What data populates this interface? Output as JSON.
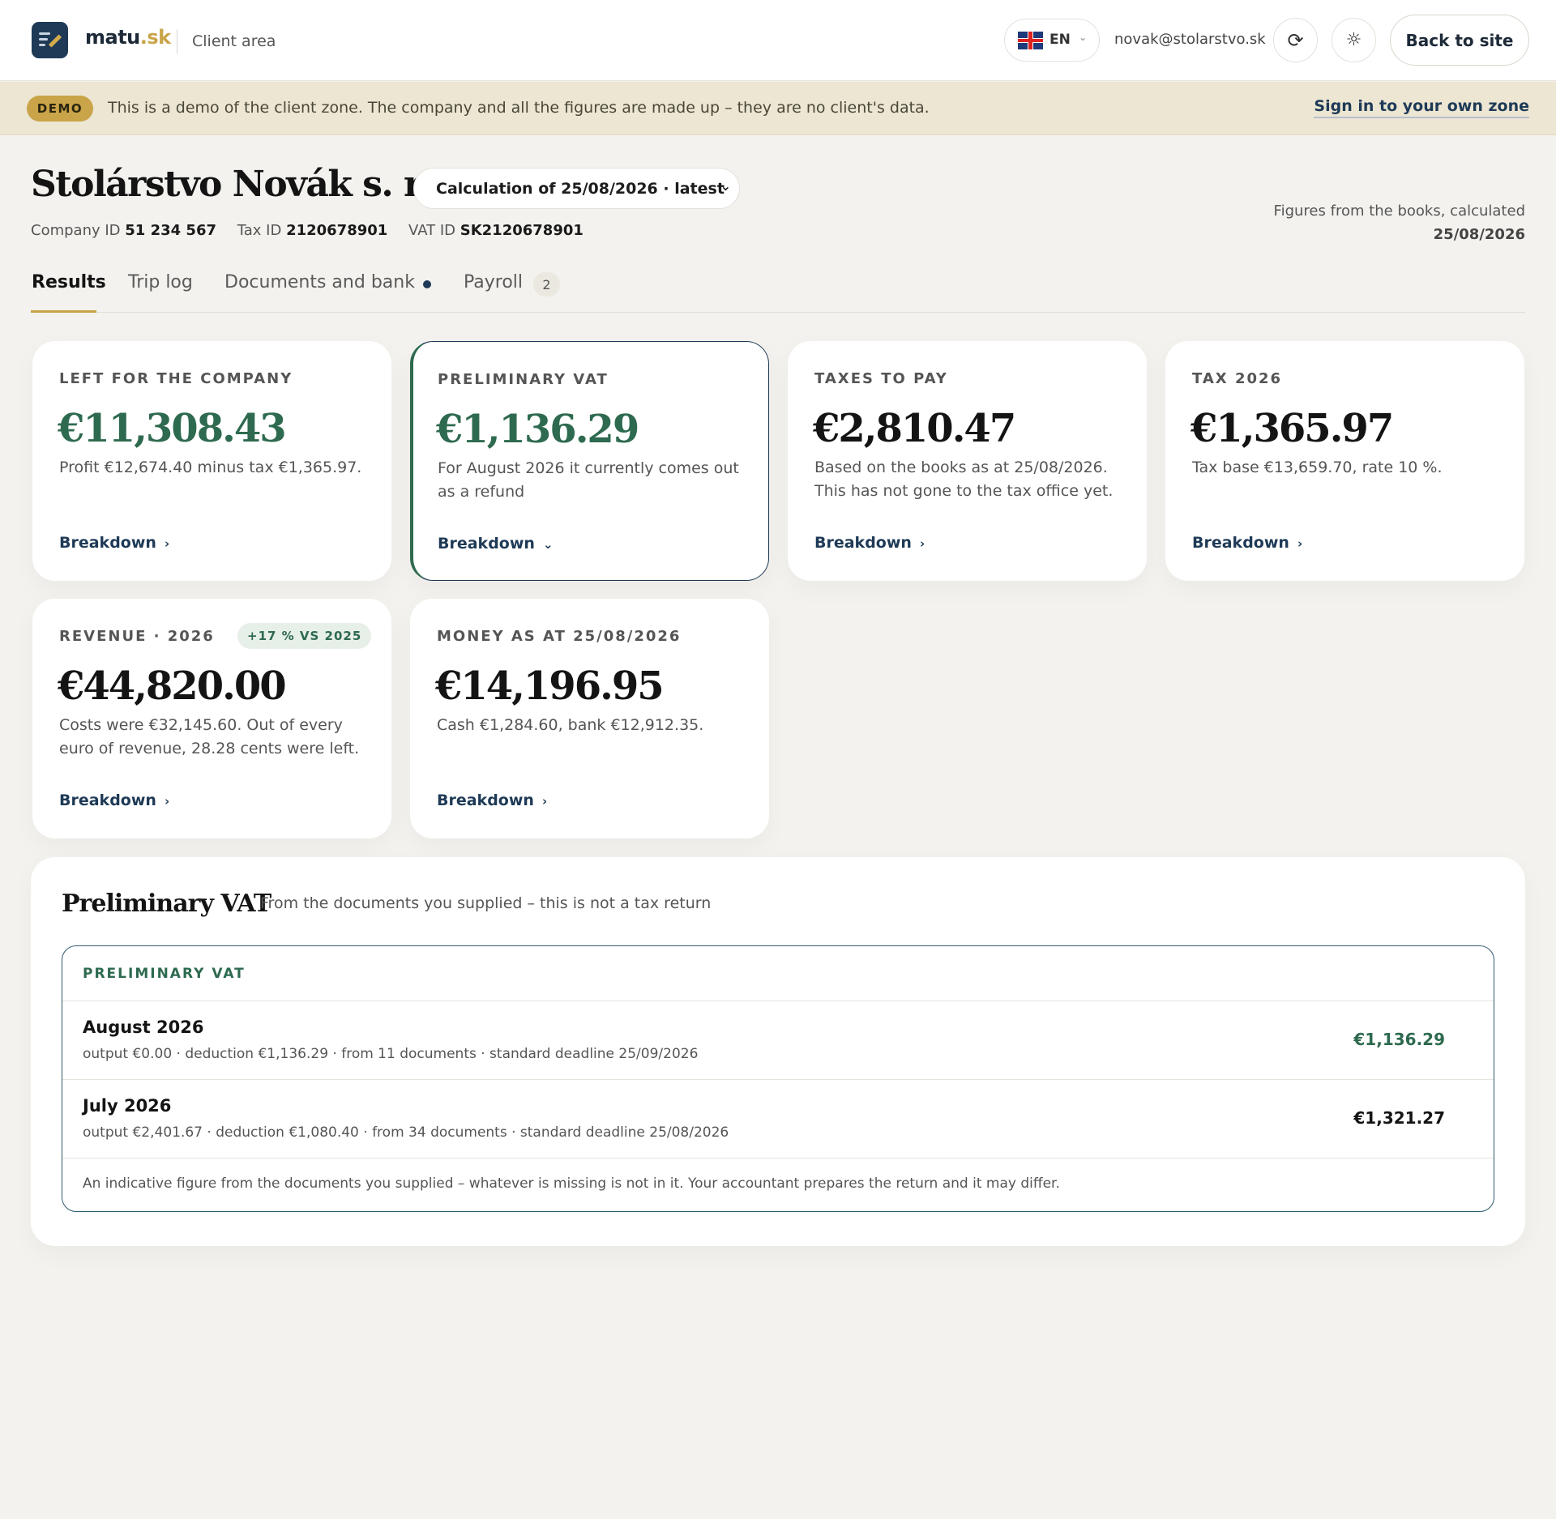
{
  "header": {
    "brand_main": "matu",
    "brand_accent": ".sk",
    "area": "Client area",
    "lang": "EN",
    "email": "novak@stolarstvo.sk",
    "back_label": "Back to site"
  },
  "demo": {
    "badge": "DEMO",
    "text": "This is a demo of the client zone. The company and all the figures are made up – they are no client's data.",
    "link": "Sign in to your own zone"
  },
  "company": {
    "name": "Stolárstvo Novák s. r. o.",
    "calc_select": "Calculation of 25/08/2026 · latest",
    "company_id_label": "Company ID",
    "company_id": "51 234 567",
    "tax_id_label": "Tax ID",
    "tax_id": "2120678901",
    "vat_id_label": "VAT ID",
    "vat_id": "SK2120678901",
    "books_note": "Figures from the books, calculated",
    "books_date": "25/08/2026"
  },
  "tabs": [
    {
      "label": "Results"
    },
    {
      "label": "Trip log"
    },
    {
      "label": "Documents and bank"
    },
    {
      "label": "Payroll",
      "count": "2"
    }
  ],
  "cards": [
    {
      "label": "Left for the company",
      "amount": "€11,308.43",
      "desc": "Profit €12,674.40 minus tax €1,365.97.",
      "link": "Breakdown"
    },
    {
      "label": "Preliminary VAT",
      "amount": "€1,136.29",
      "desc": "For August 2026 it currently comes out as a refund",
      "link": "Breakdown"
    },
    {
      "label": "Taxes to pay",
      "amount": "€2,810.47",
      "desc": "Based on the books as at 25/08/2026. This has not gone to the tax office yet.",
      "link": "Breakdown"
    },
    {
      "label": "Tax 2026",
      "amount": "€1,365.97",
      "desc": "Tax base €13,659.70, rate 10 %.",
      "link": "Breakdown"
    },
    {
      "label": "Revenue · 2026",
      "badge": "+17 % vs 2025",
      "amount": "€44,820.00",
      "desc": "Costs were €32,145.60. Out of every euro of revenue, 28.28 cents were left.",
      "link": "Breakdown"
    },
    {
      "label": "Money as at 25/08/2026",
      "amount": "€14,196.95",
      "desc": "Cash €1,284.60, bank €12,912.35.",
      "link": "Breakdown"
    }
  ],
  "vat": {
    "title": "Preliminary VAT",
    "subtitle": "From the documents you supplied – this is not a tax return",
    "box_label": "PRELIMINARY VAT",
    "rows": [
      {
        "month": "August 2026",
        "meta": "output €0.00 · deduction €1,136.29 · from 11 documents · standard deadline 25/09/2026",
        "value": "€1,136.29"
      },
      {
        "month": "July 2026",
        "meta": "output €2,401.67 · deduction €1,080.40 · from 34 documents · standard deadline 25/08/2026",
        "value": "€1,321.27"
      }
    ],
    "footnote": "An indicative figure from the documents you supplied – whatever is missing is not in it. Your accountant prepares the return and it may differ."
  },
  "colors": {
    "accent_gold": "#c9a448",
    "navy": "#1e3a56",
    "green": "#2e6a4f"
  }
}
